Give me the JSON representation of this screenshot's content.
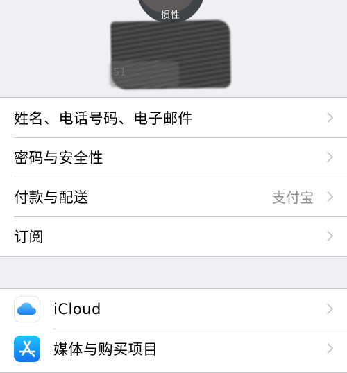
{
  "profile": {
    "avatar_caption": "惯性",
    "name_partial": "51"
  },
  "account_section": {
    "items": [
      {
        "label": "姓名、电话号码、电子邮件",
        "value": ""
      },
      {
        "label": "密码与安全性",
        "value": ""
      },
      {
        "label": "付款与配送",
        "value": "支付宝"
      },
      {
        "label": "订阅",
        "value": ""
      }
    ]
  },
  "services_section": {
    "items": [
      {
        "label": "iCloud",
        "icon": "icloud-icon"
      },
      {
        "label": "媒体与购买项目",
        "icon": "app-store-icon"
      }
    ]
  },
  "colors": {
    "background": "#efeff4",
    "separator": "#c8c7cc",
    "secondary_text": "#8e8e93",
    "chevron": "#c7c7cc"
  }
}
